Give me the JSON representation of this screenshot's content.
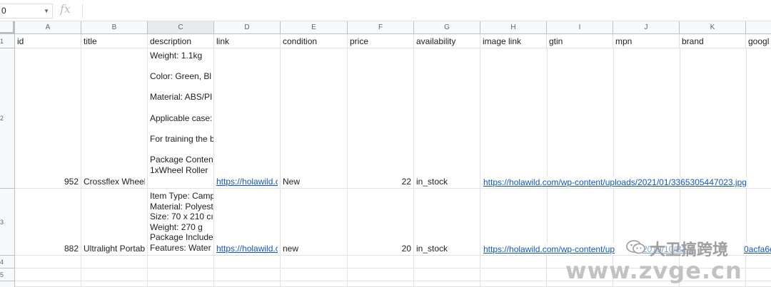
{
  "formula_bar": {
    "name_box": "0",
    "fx_symbol": "fx",
    "content": ""
  },
  "columns": [
    "A",
    "B",
    "C",
    "D",
    "E",
    "F",
    "G",
    "H",
    "I",
    "J",
    "K"
  ],
  "row_numbers": [
    "1",
    "2",
    "3",
    "4",
    "5"
  ],
  "header_row": {
    "A": "id",
    "B": "title",
    "C": "description",
    "D": "link",
    "E": "condition",
    "F": "price",
    "G": "availability",
    "H": "image link",
    "I": "gtin",
    "J": "mpn",
    "K": "brand",
    "L": "googl"
  },
  "rows": [
    {
      "id": "952",
      "title": "Crossflex Wheel",
      "description": "Weight: 1.1kg\n\nColor: Green, Bl\n\nMaterial: ABS/PI\n\nApplicable case:\n\nFor training the b\n\nPackage Conten\n1xWheel Roller",
      "link": "https://holawild.c",
      "condition": "New",
      "price": "22",
      "availability": "in_stock",
      "image_link": "https://holawild.com/wp-content/uploads/2021/01/3365305447023.jpg"
    },
    {
      "id": "882",
      "title": "Ultralight Portab",
      "description": "Item Type: Camp\nMaterial: Polyest\nSize: 70 x 210 cı\nWeight: 270 g\nPackage Include\nFeatures: Water",
      "link": "https://holawild.c",
      "condition": "new",
      "price": "20",
      "availability": "in_stock",
      "image_link": "https://holawild.com/wp-content/up",
      "image_link_tail": "2019/10/B2-4",
      "image_link_end": "0acfa6e"
    }
  ],
  "watermark": {
    "channel": "大卫搞跨境",
    "site": "www.zvge.cn",
    "color": "#bdbdbd"
  },
  "colors": {
    "link": "#1155cc",
    "header_bg": "#f8f9fa",
    "grid": "#e2e2e2"
  }
}
